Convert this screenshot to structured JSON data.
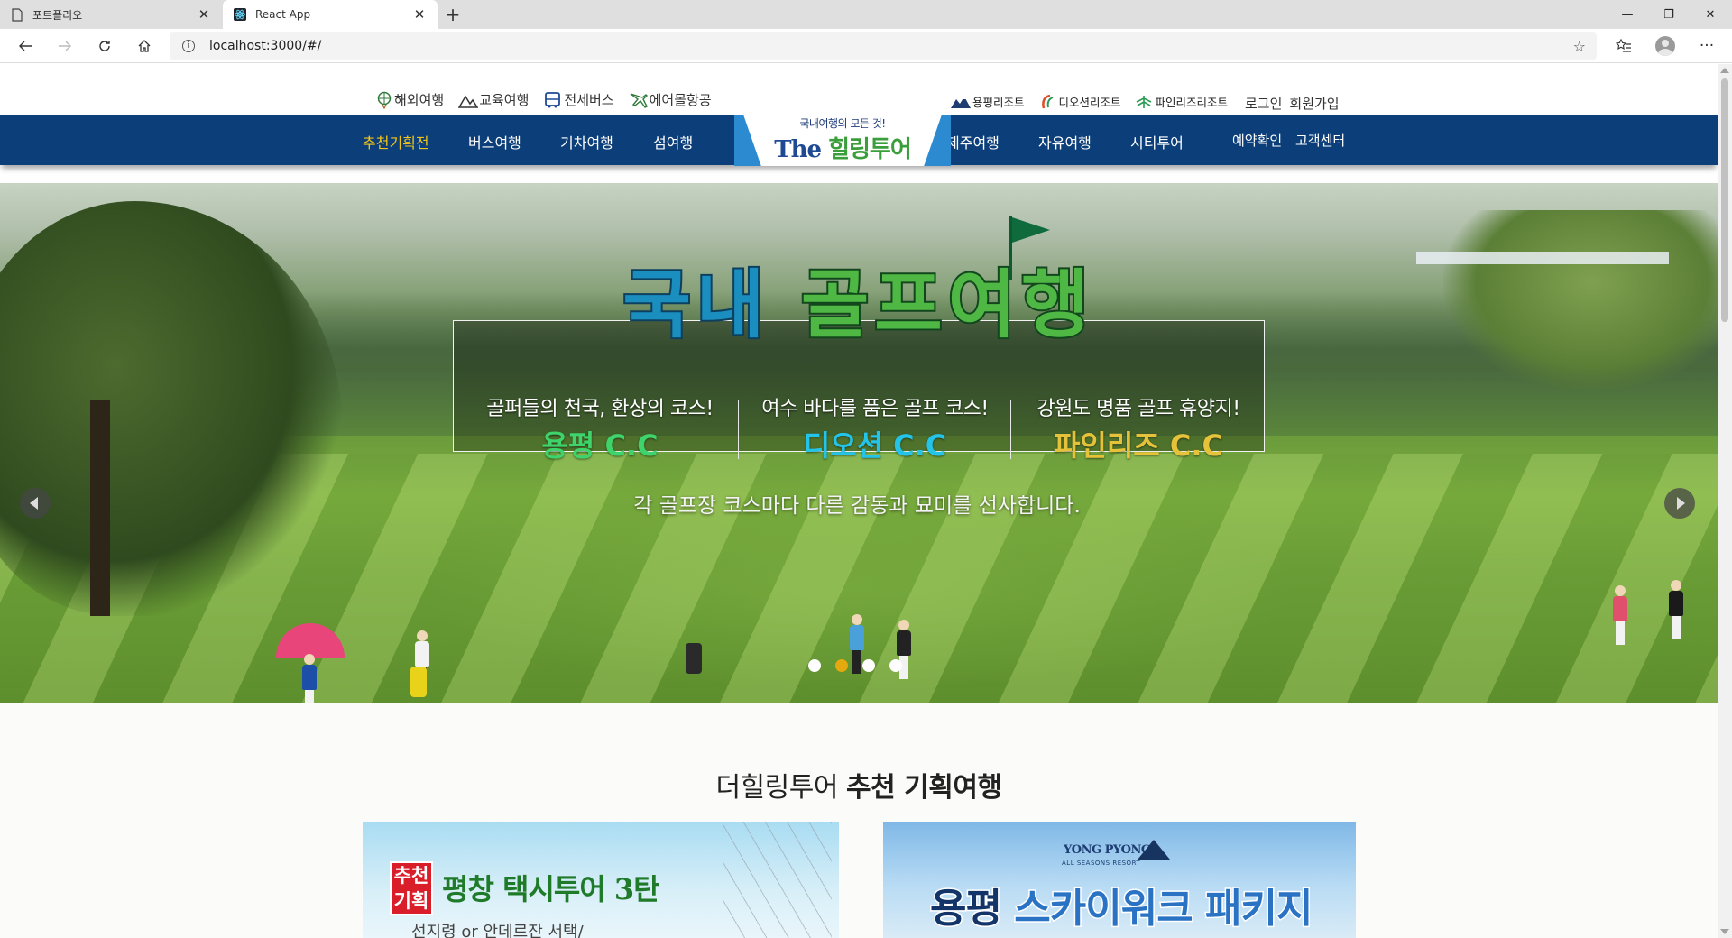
{
  "browser": {
    "tabs": [
      {
        "title": "포트폴리오",
        "icon": "page-icon"
      },
      {
        "title": "React App",
        "icon": "react-icon"
      }
    ],
    "url": "localhost:3000/#/"
  },
  "header": {
    "top_menu": [
      {
        "label": "해외여행",
        "icon": "globe-balloon-icon"
      },
      {
        "label": "교육여행",
        "icon": "mountain-icon"
      },
      {
        "label": "전세버스",
        "icon": "bus-icon"
      },
      {
        "label": "에어몰항공",
        "icon": "airplane-icon"
      }
    ],
    "resorts": [
      {
        "label": "용평리조트",
        "icon": "yongpyong-mountain-icon"
      },
      {
        "label": "디오션리조트",
        "icon": "wave-icon"
      },
      {
        "label": "파인리즈리조트",
        "icon": "pine-icon"
      }
    ],
    "account": {
      "login": "로그인",
      "signup": "회원가입"
    },
    "nav_left": [
      "추천기획전",
      "버스여행",
      "기차여행",
      "섬여행"
    ],
    "nav_right": [
      "제주여행",
      "자유여행",
      "시티투어"
    ],
    "nav_util": [
      "예약확인",
      "고객센터"
    ],
    "logo": {
      "tagline": "국내여행의 모든 것!",
      "the": "The",
      "name": "힐링투어"
    }
  },
  "hero": {
    "title_part1": "국내",
    "title_part2": "골프여행",
    "courses": [
      {
        "tagline": "골퍼들의 천국, 환상의 코스!",
        "name": "용평 C.C",
        "color": "#3fd36b"
      },
      {
        "tagline": "여수 바다를 품은 골프 코스!",
        "name": "디오션 C.C",
        "color": "#24c3e8"
      },
      {
        "tagline": "강원도 명품 골프 휴양지!",
        "name": "파인리즈 C.C",
        "color": "#e5c23a"
      }
    ],
    "description": "각 골프장 코스마다 다른 감동과 묘미를 선사합니다.",
    "slides": 4,
    "active_slide": 2
  },
  "section": {
    "title_light": "더힐링투어",
    "title_bold": "추천 기획여행",
    "cards": [
      {
        "badge_top": "추천",
        "badge_bottom": "기획",
        "title": "평창 택시투어 3탄",
        "sub": "선지령 or 안데르잔 서택/"
      },
      {
        "brand": "YONG PYONG",
        "brand_sub": "ALL SEASONS RESORT",
        "title_a": "용평",
        "title_b": "스카이워크 패키지"
      }
    ]
  },
  "colors": {
    "nav_bg": "#0c3f7a",
    "nav_active": "#f2c418",
    "dot_active": "#e3a90e"
  }
}
